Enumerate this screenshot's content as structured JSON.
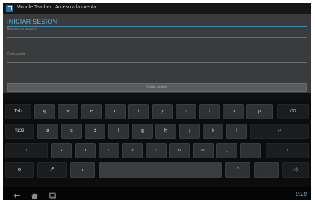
{
  "window": {
    "title": "Moodle Teacher | Acceso a la cuenta"
  },
  "form": {
    "heading": "INICIAR SESION",
    "username_placeholder": "Nombre de usuario",
    "password_placeholder": "Contraseña",
    "login_label": "Iniciar sesion"
  },
  "keyboard": {
    "row1": [
      "Tab",
      "q",
      "w",
      "e",
      "r",
      "t",
      "y",
      "u",
      "i",
      "o",
      "p",
      "⌫"
    ],
    "row2": [
      "?123",
      "a",
      "s",
      "d",
      "f",
      "g",
      "h",
      "j",
      "k",
      "l",
      "↵"
    ],
    "row3": [
      "⇧",
      "z",
      "x",
      "c",
      "v",
      "b",
      "n",
      "m",
      ",",
      ".",
      "⇧"
    ],
    "row4": [
      "⚙",
      "🎤",
      "/",
      "",
      "'",
      "-",
      ":-)"
    ]
  },
  "status": {
    "time": "9:29",
    "icons": [
      "back-icon",
      "home-icon",
      "recent-apps-icon"
    ]
  },
  "colors": {
    "accent": "#59b3e6"
  }
}
